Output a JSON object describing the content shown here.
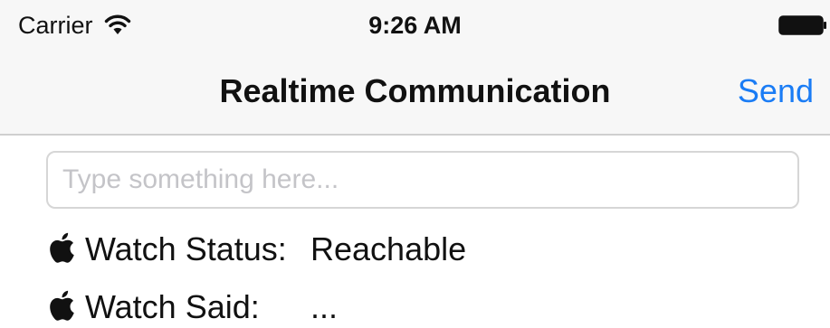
{
  "status_bar": {
    "carrier": "Carrier",
    "time": "9:26 AM",
    "wifi_icon": "wifi-icon",
    "battery_icon": "battery-full-icon"
  },
  "nav_bar": {
    "title": "Realtime Communication",
    "send_label": "Send",
    "accent_color": "#1a7cf5"
  },
  "input": {
    "placeholder": "Type something here...",
    "value": ""
  },
  "rows": [
    {
      "icon": "apple-logo-icon",
      "label": "Watch Status:",
      "value": "Reachable"
    },
    {
      "icon": "apple-logo-icon",
      "label": "Watch Said:",
      "value": "..."
    }
  ]
}
